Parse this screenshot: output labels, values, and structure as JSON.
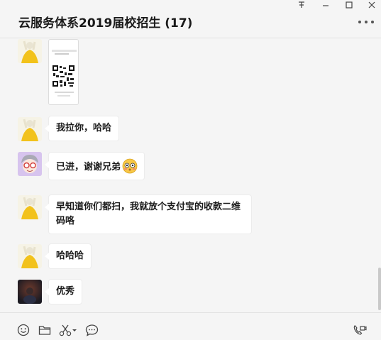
{
  "window": {
    "title": "云服务体系2019届校招生 (17)",
    "controls": [
      "pin-icon",
      "minimize-icon",
      "maximize-icon",
      "close-icon"
    ]
  },
  "messages": [
    {
      "type": "image",
      "avatar": "yellow-figure",
      "content": "qr-code-screenshot"
    },
    {
      "type": "text",
      "avatar": "yellow-figure",
      "text": "我拉你，哈哈"
    },
    {
      "type": "text",
      "avatar": "glasses-cartoon",
      "text": "已进，谢谢兄弟",
      "emoji": "blush-emoji"
    },
    {
      "type": "text",
      "avatar": "yellow-figure",
      "text": "早知道你们都扫，我就放个支付宝的收款二维码咯"
    },
    {
      "type": "text",
      "avatar": "yellow-figure",
      "text": "哈哈哈"
    },
    {
      "type": "text",
      "avatar": "dark-photo",
      "text": "优秀"
    }
  ],
  "toolbar": [
    "emoji-icon",
    "folder-icon",
    "scissors-icon",
    "chat-bubble-icon",
    "video-call-icon"
  ],
  "colors": {
    "background": "#f5f5f5",
    "bubble": "#ffffff",
    "avatar_yellow": "#f2c21b"
  }
}
